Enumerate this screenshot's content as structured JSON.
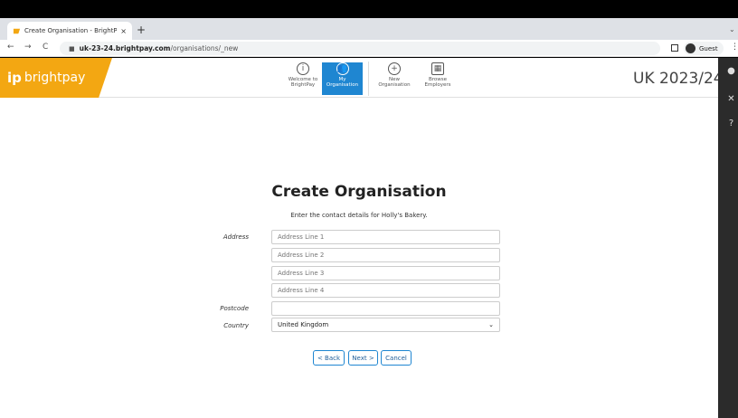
{
  "browser": {
    "tab_title": "Create Organisation - BrightPay",
    "tab_close": "×",
    "new_tab": "+",
    "tab_menu": "⌄",
    "back": "←",
    "forward": "→",
    "reload": "C",
    "lock": "🔒",
    "url_host": "uk-23-24.brightpay.com",
    "url_path": "/organisations/_new",
    "profile": "Guest",
    "menu": "⋮"
  },
  "app": {
    "logo_mark": "ip",
    "logo_text": "brightpay",
    "year": "UK 2023/24",
    "brand_color": "#f3a712",
    "accent_color": "#1f86d1",
    "nav": [
      {
        "line1": "Welcome to",
        "line2": "BrightPay",
        "icon": "i"
      },
      {
        "line1": "My",
        "line2": "Organisation",
        "icon": "👥"
      },
      {
        "line1": "New",
        "line2": "Organisation",
        "icon": "+"
      },
      {
        "line1": "Browse",
        "line2": "Employers",
        "icon": "▦"
      }
    ]
  },
  "form": {
    "heading": "Create Organisation",
    "subheading": "Enter the contact details for Holly's Bakery.",
    "address_label": "Address",
    "address_placeholders": [
      "Address Line 1",
      "Address Line 2",
      "Address Line 3",
      "Address Line 4"
    ],
    "postcode_label": "Postcode",
    "postcode_value": "",
    "country_label": "Country",
    "country_value": "United Kingdom",
    "country_chevron": "⌄",
    "back_button": "< Back",
    "next_button": "Next >",
    "cancel_button": "Cancel"
  },
  "rail": {
    "user": "●",
    "tools": "✕",
    "help": "?"
  }
}
